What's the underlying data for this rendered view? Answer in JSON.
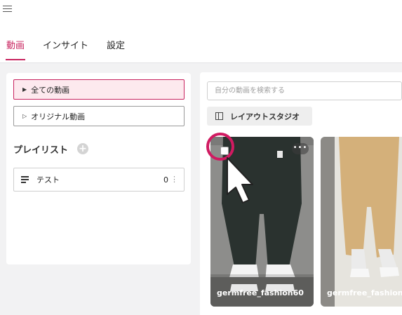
{
  "header": {
    "tabs": [
      {
        "label": "動画",
        "active": true
      },
      {
        "label": "インサイト",
        "active": false
      },
      {
        "label": "設定",
        "active": false
      }
    ]
  },
  "sidebar": {
    "all_videos_label": "全ての動画",
    "original_videos_label": "オリジナル動画",
    "playlist_heading": "プレイリスト",
    "playlists": [
      {
        "name": "テスト",
        "count": "0"
      }
    ]
  },
  "main": {
    "search_placeholder": "自分の動画を検索する",
    "layout_studio_label": "レイアウトスタジオ",
    "videos": [
      {
        "title": "germfree_fashion60"
      },
      {
        "title": "germfree_fashion"
      }
    ]
  },
  "colors": {
    "accent": "#c8245f",
    "highlight_ring": "#d01a61",
    "active_bg": "#fde9ee"
  }
}
